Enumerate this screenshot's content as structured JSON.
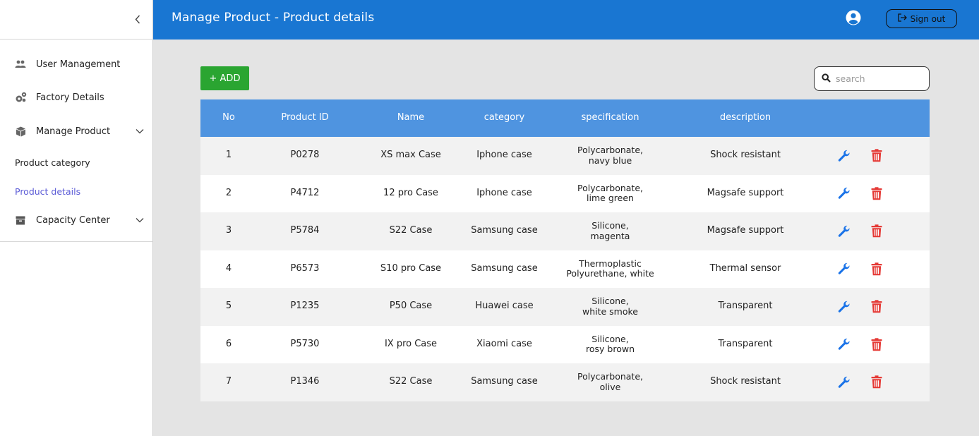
{
  "header": {
    "title": "Manage Product - Product details",
    "signout_label": "Sign out",
    "accent_color": "#1976d2"
  },
  "sidebar": {
    "items": [
      {
        "label": "User Management",
        "icon": "users-icon"
      },
      {
        "label": "Factory Details",
        "icon": "gears-icon"
      },
      {
        "label": "Manage Product",
        "icon": "cube-icon"
      },
      {
        "label": "Product category"
      },
      {
        "label": "Product details",
        "active": true
      },
      {
        "label": "Capacity Center",
        "icon": "archive-icon"
      }
    ]
  },
  "toolbar": {
    "add_label": "+ ADD",
    "search_placeholder": "search"
  },
  "table": {
    "columns": [
      "No",
      "Product ID",
      "Name",
      "category",
      "specification",
      "description"
    ],
    "rows": [
      {
        "no": "1",
        "id": "P0278",
        "name": "XS max Case",
        "category": "Iphone case",
        "spec1": "Polycarbonate,",
        "spec2": "navy blue",
        "description": "Shock resistant"
      },
      {
        "no": "2",
        "id": "P4712",
        "name": "12 pro Case",
        "category": "Iphone case",
        "spec1": "Polycarbonate,",
        "spec2": "lime green",
        "description": "Magsafe support"
      },
      {
        "no": "3",
        "id": "P5784",
        "name": "S22 Case",
        "category": "Samsung case",
        "spec1": "Silicone,",
        "spec2": "magenta",
        "description": "Magsafe support"
      },
      {
        "no": "4",
        "id": "P6573",
        "name": "S10 pro Case",
        "category": "Samsung case",
        "spec1": "Thermoplastic",
        "spec2": "Polyurethane, white",
        "description": "Thermal sensor"
      },
      {
        "no": "5",
        "id": "P1235",
        "name": "P50 Case",
        "category": "Huawei case",
        "spec1": "Silicone,",
        "spec2": "white smoke",
        "description": "Transparent"
      },
      {
        "no": "6",
        "id": "P5730",
        "name": "IX pro Case",
        "category": "Xiaomi case",
        "spec1": "Silicone,",
        "spec2": "rosy brown",
        "description": "Transparent"
      },
      {
        "no": "7",
        "id": "P1346",
        "name": "S22 Case",
        "category": "Samsung case",
        "spec1": "Polycarbonate,",
        "spec2": "olive",
        "description": "Shock resistant"
      }
    ]
  },
  "colors": {
    "header_bg": "#1976d2",
    "table_header_bg": "#4f94e0",
    "add_button": "#2aa531",
    "edit_icon": "#1a73e8",
    "delete_icon": "#e53935",
    "active_link": "#5b5bd6"
  }
}
